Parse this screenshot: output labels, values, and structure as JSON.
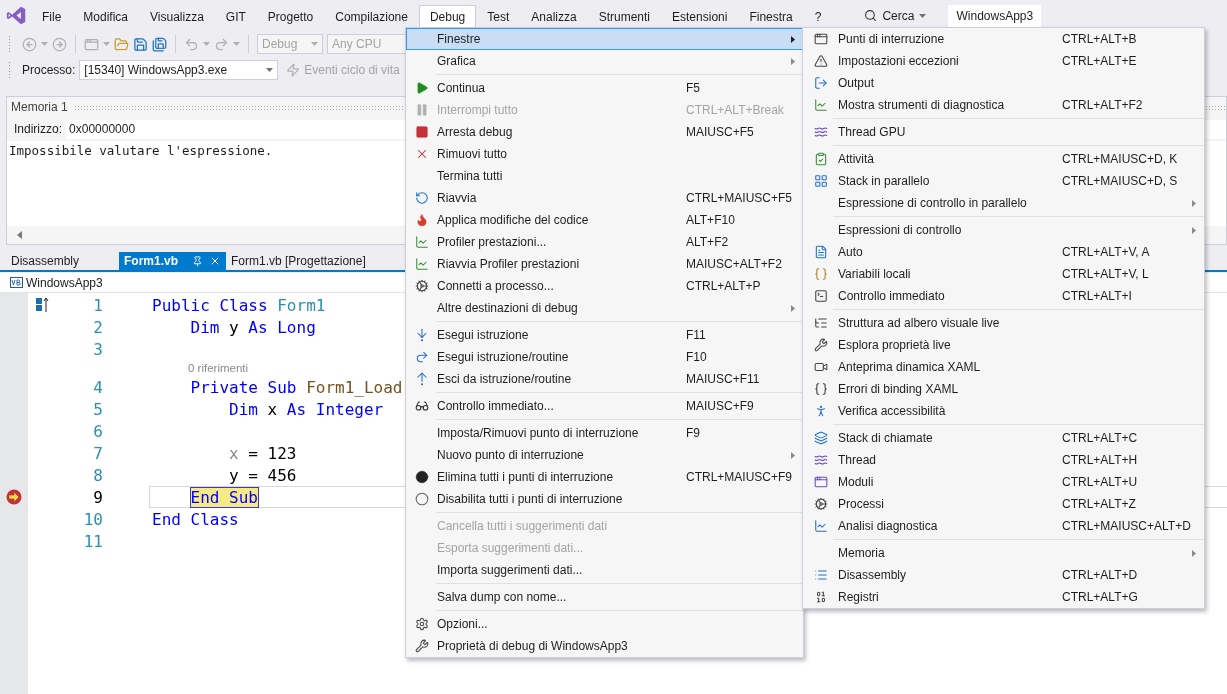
{
  "menu_bar": [
    {
      "label": "File",
      "selected": false
    },
    {
      "label": "Modifica",
      "selected": false
    },
    {
      "label": "Visualizza",
      "selected": false
    },
    {
      "label": "GIT",
      "selected": false
    },
    {
      "label": "Progetto",
      "selected": false
    },
    {
      "label": "Compilazione",
      "selected": false
    },
    {
      "label": "Debug",
      "selected": true
    },
    {
      "label": "Test",
      "selected": false
    },
    {
      "label": "Analizza",
      "selected": false
    },
    {
      "label": "Strumenti",
      "selected": false
    },
    {
      "label": "Estensioni",
      "selected": false
    },
    {
      "label": "Finestra",
      "selected": false
    },
    {
      "label": "?",
      "selected": false
    }
  ],
  "search": {
    "label": "Cerca"
  },
  "window": {
    "title": "WindowsApp3"
  },
  "toolbar": {
    "configuration": "Debug",
    "platform": "Any CPU",
    "process_label": "Processo:",
    "process": "[15340] WindowsApp3.exe",
    "lifecycle": "Eventi ciclo di vita"
  },
  "memory_panel": {
    "title": "Memoria 1",
    "address_label": "Indirizzo:",
    "address": "0x00000000",
    "message": "Impossibile valutare l'espressione."
  },
  "editor_tabs": [
    {
      "label": "Disassembly",
      "selected": false
    },
    {
      "label": "Form1.vb",
      "selected": true
    },
    {
      "label": "Form1.vb [Progettazione]",
      "selected": false
    }
  ],
  "navigation": {
    "project": "WindowsApp3"
  },
  "code_lines": [
    {
      "kind": "line",
      "number": "1",
      "current": false,
      "parts": [
        {
          "kind": "keyword",
          "text": "Public Class "
        },
        {
          "kind": "type",
          "text": "Form1"
        }
      ]
    },
    {
      "kind": "line",
      "number": "2",
      "current": false,
      "parts": [
        {
          "kind": "keyword",
          "text": "    Dim "
        },
        {
          "kind": "plain",
          "text": "y "
        },
        {
          "kind": "keyword",
          "text": "As Long"
        }
      ]
    },
    {
      "kind": "line",
      "number": "3",
      "current": false
    },
    {
      "kind": "codelens",
      "text": "0 riferimenti"
    },
    {
      "kind": "line",
      "number": "4",
      "current": false,
      "parts": [
        {
          "kind": "keyword",
          "text": "    Private Sub "
        },
        {
          "kind": "method",
          "text": "Form1_Load"
        }
      ]
    },
    {
      "kind": "line",
      "number": "5",
      "current": false,
      "parts": [
        {
          "kind": "keyword",
          "text": "        Dim "
        },
        {
          "kind": "plain",
          "text": "x "
        },
        {
          "kind": "keyword",
          "text": "As Integer"
        }
      ]
    },
    {
      "kind": "line",
      "number": "6",
      "current": false
    },
    {
      "kind": "line",
      "number": "7",
      "current": false,
      "parts": [
        {
          "kind": "unused",
          "text": "        x"
        },
        {
          "kind": "plain",
          "text": " = 123"
        }
      ]
    },
    {
      "kind": "line",
      "number": "8",
      "current": false,
      "parts": [
        {
          "kind": "plain",
          "text": "        y = 456"
        }
      ]
    },
    {
      "kind": "line",
      "number": "9",
      "current": true,
      "parts": [
        {
          "kind": "highlight",
          "text": "    End Sub"
        }
      ]
    },
    {
      "kind": "line",
      "number": "10",
      "current": false,
      "parts": [
        {
          "kind": "keyword",
          "text": "End Class"
        }
      ]
    },
    {
      "kind": "line",
      "number": "11",
      "current": false
    }
  ],
  "debug_menu": {
    "items": [
      {
        "kind": "item",
        "label": "Finestre",
        "submenu": true,
        "selected": true,
        "disabled": false
      },
      {
        "kind": "item",
        "label": "Grafica",
        "submenu": true,
        "selected": false,
        "disabled": false
      },
      {
        "kind": "separator"
      },
      {
        "kind": "item",
        "label": "Continua",
        "shortcut": "F5",
        "submenu": false,
        "selected": false,
        "disabled": false
      },
      {
        "kind": "item",
        "label": "Interrompi tutto",
        "shortcut": "CTRL+ALT+Break",
        "submenu": false,
        "selected": false,
        "disabled": true
      },
      {
        "kind": "item",
        "label": "Arresta debug",
        "shortcut": "MAIUSC+F5",
        "submenu": false,
        "selected": false,
        "disabled": false
      },
      {
        "kind": "item",
        "label": "Rimuovi tutto",
        "submenu": false,
        "selected": false,
        "disabled": false
      },
      {
        "kind": "item",
        "label": "Termina tutti",
        "submenu": false,
        "selected": false,
        "disabled": false
      },
      {
        "kind": "item",
        "label": "Riavvia",
        "shortcut": "CTRL+MAIUSC+F5",
        "submenu": false,
        "selected": false,
        "disabled": false
      },
      {
        "kind": "item",
        "label": "Applica modifiche del codice",
        "shortcut": "ALT+F10",
        "submenu": false,
        "selected": false,
        "disabled": false
      },
      {
        "kind": "item",
        "label": "Profiler prestazioni...",
        "shortcut": "ALT+F2",
        "submenu": false,
        "selected": false,
        "disabled": false
      },
      {
        "kind": "item",
        "label": "Riavvia Profiler prestazioni",
        "shortcut": "MAIUSC+ALT+F2",
        "submenu": false,
        "selected": false,
        "disabled": false
      },
      {
        "kind": "item",
        "label": "Connetti a processo...",
        "shortcut": "CTRL+ALT+P",
        "submenu": false,
        "selected": false,
        "disabled": false
      },
      {
        "kind": "item",
        "label": "Altre destinazioni di debug",
        "submenu": true,
        "selected": false,
        "disabled": false
      },
      {
        "kind": "separator"
      },
      {
        "kind": "item",
        "label": "Esegui istruzione",
        "shortcut": "F11",
        "submenu": false,
        "selected": false,
        "disabled": false
      },
      {
        "kind": "item",
        "label": "Esegui istruzione/routine",
        "shortcut": "F10",
        "submenu": false,
        "selected": false,
        "disabled": false
      },
      {
        "kind": "item",
        "label": "Esci da istruzione/routine",
        "shortcut": "MAIUSC+F11",
        "submenu": false,
        "selected": false,
        "disabled": false
      },
      {
        "kind": "separator"
      },
      {
        "kind": "item",
        "label": "Controllo immediato...",
        "shortcut": "MAIUSC+F9",
        "submenu": false,
        "selected": false,
        "disabled": false
      },
      {
        "kind": "separator"
      },
      {
        "kind": "item",
        "label": "Imposta/Rimuovi punto di interruzione",
        "shortcut": "F9",
        "submenu": false,
        "selected": false,
        "disabled": false
      },
      {
        "kind": "item",
        "label": "Nuovo punto di interruzione",
        "submenu": true,
        "selected": false,
        "disabled": false
      },
      {
        "kind": "item",
        "label": "Elimina tutti i punti di interruzione",
        "shortcut": "CTRL+MAIUSC+F9",
        "submenu": false,
        "selected": false,
        "disabled": false
      },
      {
        "kind": "item",
        "label": "Disabilita tutti i punti di interruzione",
        "submenu": false,
        "selected": false,
        "disabled": false
      },
      {
        "kind": "separator"
      },
      {
        "kind": "item",
        "label": "Cancella tutti i suggerimenti dati",
        "submenu": false,
        "selected": false,
        "disabled": true
      },
      {
        "kind": "item",
        "label": "Esporta suggerimenti dati...",
        "submenu": false,
        "selected": false,
        "disabled": true
      },
      {
        "kind": "item",
        "label": "Importa suggerimenti dati...",
        "submenu": false,
        "selected": false,
        "disabled": false
      },
      {
        "kind": "separator"
      },
      {
        "kind": "item",
        "label": "Salva dump con nome...",
        "submenu": false,
        "selected": false,
        "disabled": false
      },
      {
        "kind": "separator"
      },
      {
        "kind": "item",
        "label": "Opzioni...",
        "submenu": false,
        "selected": false,
        "disabled": false
      },
      {
        "kind": "item",
        "label": "Proprietà di debug di WindowsApp3",
        "submenu": false,
        "selected": false,
        "disabled": false
      }
    ]
  },
  "windows_submenu": {
    "items": [
      {
        "kind": "item",
        "label": "Punti di interruzione",
        "shortcut": "CTRL+ALT+B",
        "submenu": false,
        "selected": false,
        "disabled": false
      },
      {
        "kind": "item",
        "label": "Impostazioni eccezioni",
        "shortcut": "CTRL+ALT+E",
        "submenu": false,
        "selected": false,
        "disabled": false
      },
      {
        "kind": "item",
        "label": "Output",
        "submenu": false,
        "selected": false,
        "disabled": false
      },
      {
        "kind": "item",
        "label": "Mostra strumenti di diagnostica",
        "shortcut": "CTRL+ALT+F2",
        "submenu": false,
        "selected": false,
        "disabled": false
      },
      {
        "kind": "separator"
      },
      {
        "kind": "item",
        "label": "Thread GPU",
        "submenu": false,
        "selected": false,
        "disabled": false
      },
      {
        "kind": "separator"
      },
      {
        "kind": "item",
        "label": "Attività",
        "shortcut": "CTRL+MAIUSC+D, K",
        "submenu": false,
        "selected": false,
        "disabled": false
      },
      {
        "kind": "item",
        "label": "Stack in parallelo",
        "shortcut": "CTRL+MAIUSC+D, S",
        "submenu": false,
        "selected": false,
        "disabled": false
      },
      {
        "kind": "item",
        "label": "Espressione di controllo in parallelo",
        "submenu": true,
        "selected": false,
        "disabled": false
      },
      {
        "kind": "separator"
      },
      {
        "kind": "item",
        "label": "Espressioni di controllo",
        "submenu": true,
        "selected": false,
        "disabled": false
      },
      {
        "kind": "item",
        "label": "Auto",
        "shortcut": "CTRL+ALT+V, A",
        "submenu": false,
        "selected": false,
        "disabled": false
      },
      {
        "kind": "item",
        "label": "Variabili locali",
        "shortcut": "CTRL+ALT+V, L",
        "submenu": false,
        "selected": false,
        "disabled": false
      },
      {
        "kind": "item",
        "label": "Controllo immediato",
        "shortcut": "CTRL+ALT+I",
        "submenu": false,
        "selected": false,
        "disabled": false
      },
      {
        "kind": "separator"
      },
      {
        "kind": "item",
        "label": "Struttura ad albero visuale live",
        "submenu": false,
        "selected": false,
        "disabled": false
      },
      {
        "kind": "item",
        "label": "Esplora proprietà live",
        "submenu": false,
        "selected": false,
        "disabled": false
      },
      {
        "kind": "item",
        "label": "Anteprima dinamica XAML",
        "submenu": false,
        "selected": false,
        "disabled": false
      },
      {
        "kind": "item",
        "label": "Errori di binding XAML",
        "submenu": false,
        "selected": false,
        "disabled": false
      },
      {
        "kind": "item",
        "label": "Verifica accessibilità",
        "submenu": false,
        "selected": false,
        "disabled": false
      },
      {
        "kind": "separator"
      },
      {
        "kind": "item",
        "label": "Stack di chiamate",
        "shortcut": "CTRL+ALT+C",
        "submenu": false,
        "selected": false,
        "disabled": false
      },
      {
        "kind": "item",
        "label": "Thread",
        "shortcut": "CTRL+ALT+H",
        "submenu": false,
        "selected": false,
        "disabled": false
      },
      {
        "kind": "item",
        "label": "Moduli",
        "shortcut": "CTRL+ALT+U",
        "submenu": false,
        "selected": false,
        "disabled": false
      },
      {
        "kind": "item",
        "label": "Processi",
        "shortcut": "CTRL+ALT+Z",
        "submenu": false,
        "selected": false,
        "disabled": false
      },
      {
        "kind": "item",
        "label": "Analisi diagnostica",
        "shortcut": "CTRL+MAIUSC+ALT+D",
        "submenu": false,
        "selected": false,
        "disabled": false
      },
      {
        "kind": "separator"
      },
      {
        "kind": "item",
        "label": "Memoria",
        "submenu": true,
        "selected": false,
        "disabled": false
      },
      {
        "kind": "item",
        "label": "Disassembly",
        "shortcut": "CTRL+ALT+D",
        "submenu": false,
        "selected": false,
        "disabled": false
      },
      {
        "kind": "item",
        "label": "Registri",
        "shortcut": "CTRL+ALT+G",
        "submenu": false,
        "selected": false,
        "disabled": false
      }
    ]
  }
}
